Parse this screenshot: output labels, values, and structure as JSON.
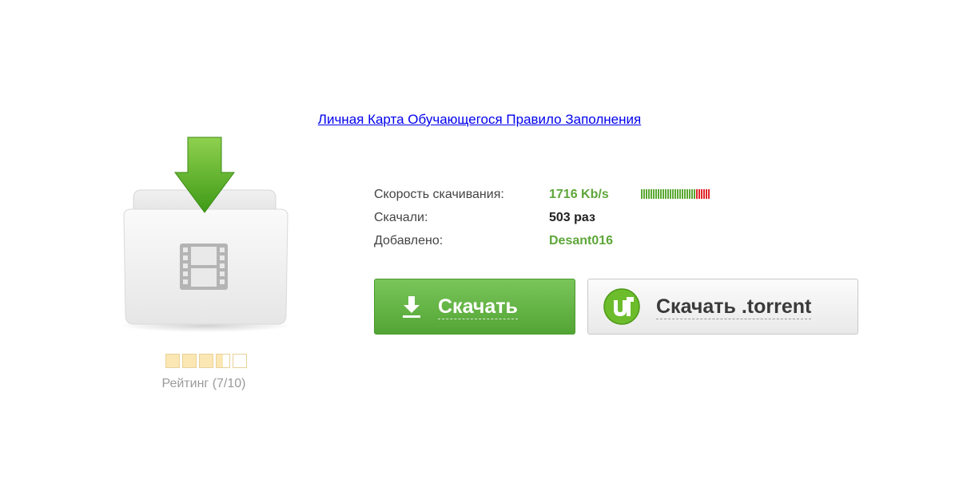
{
  "page": {
    "title_link": "Личная Карта Обучающегося Правило Заполнения"
  },
  "file": {
    "icon": "video-file-download-icon",
    "rating": {
      "value": 7,
      "max": 10,
      "stars_total": 5,
      "label": "Рейтинг (7/10)"
    }
  },
  "info": {
    "speed_label": "Скорость скачивания:",
    "speed_value": "1716 Kb/s",
    "speed_level": 0.78,
    "downloads_label": "Скачали:",
    "downloads_value": "503 раз",
    "added_label": "Добавлено:",
    "added_value": "Desant016"
  },
  "buttons": {
    "download_label": "Скачать",
    "download_icon": "download-arrow-icon",
    "torrent_label": "Скачать .torrent",
    "torrent_icon": "utorrent-logo-icon"
  },
  "colors": {
    "link": "#0000ee",
    "accent_green": "#5ea63a",
    "download_button": "#62b443",
    "torrent_button": "#f2f2f2",
    "speed_good": "#5aa832",
    "speed_bad": "#e0262b",
    "rating_fill": "#fbe7b3"
  }
}
